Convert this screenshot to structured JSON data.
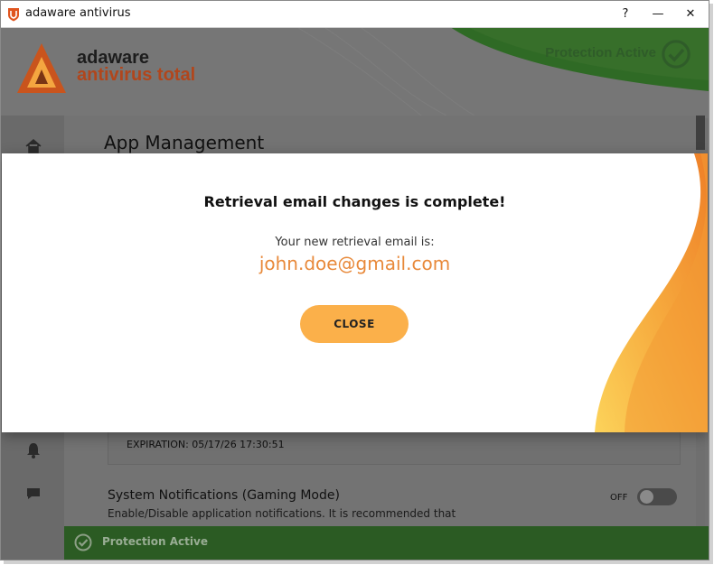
{
  "window": {
    "title": "adaware antivirus",
    "help_label": "?",
    "minimize_label": "—",
    "close_label": "✕"
  },
  "brand": {
    "line1": "adaware",
    "line2": "antivirus total"
  },
  "header": {
    "protection_status": "Protection Active"
  },
  "page": {
    "title": "App Management",
    "expiration": "EXPIRATION: 05/17/26 17:30:51",
    "notifications_title": "System Notifications (Gaming Mode)",
    "notifications_desc": "Enable/Disable application notifications. It is recommended that",
    "toggle_state": "OFF"
  },
  "statusbar": {
    "text": "Protection Active"
  },
  "modal": {
    "heading": "Retrieval email changes is complete!",
    "subtitle": "Your new retrieval email is:",
    "email": "john.doe@gmail.com",
    "close_label": "CLOSE"
  },
  "colors": {
    "brand_orange": "#b1461c",
    "accent_orange": "#e8893a",
    "button_orange": "#fbb04a",
    "status_green": "#2b5b23"
  }
}
